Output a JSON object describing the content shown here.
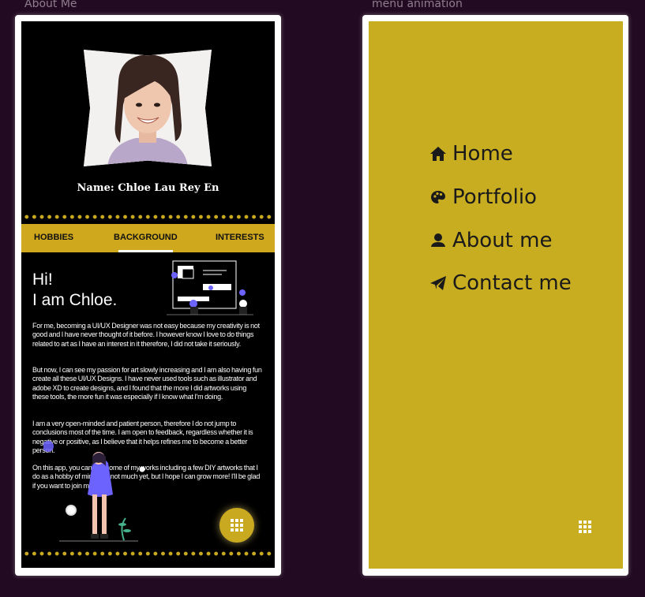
{
  "captions": {
    "left": "About Me",
    "right": "menu animation"
  },
  "profile": {
    "name": "Name: Chloe Lau Rey En",
    "tabs": [
      {
        "label": "HOBBIES",
        "active": false
      },
      {
        "label": "BACKGROUND",
        "active": true
      },
      {
        "label": "INTERESTS",
        "active": false
      }
    ],
    "greeting": "Hi!\nI am Chloe.",
    "paragraphs": [
      "For me, becoming a UI/UX Designer was not easy because my creativity is not good and I have never thought of it before. I however know I love to do things related to art as I have an interest in it therefore, I did not take it seriously.",
      "But now, I can see my passion for art slowly increasing and I am also having fun create all these UI/UX Designs. I have never used tools such as illustrator and adobe XD to create designs, and I found that the more I did artworks using these tools, the more fun it was especially if I know what I'm doing.",
      "I am a very open-minded and patient person, therefore I do not jump to conclusions most of the time. I am open to feedback, regardless whether it is negative or positive, as I believe that it helps refines me to become a better person.",
      "On this app, you can see some of my works including a few DIY artworks that I do as a hobby of mine. It is not much yet, but I hope I can grow more! I'll be glad if you want to join me!"
    ],
    "fab_icon": "grid-icon"
  },
  "menu": {
    "items": [
      {
        "label": "Home",
        "icon": "home-icon"
      },
      {
        "label": "Portfolio",
        "icon": "palette-icon"
      },
      {
        "label": "About me",
        "icon": "user-icon"
      },
      {
        "label": "Contact me",
        "icon": "paper-plane-icon"
      }
    ],
    "toggle_icon": "grid-icon"
  },
  "colors": {
    "background": "#220a22",
    "accent_gold": "#cfa81d",
    "menu_background": "#c9ad20",
    "illustration_purple": "#6c63ff"
  }
}
